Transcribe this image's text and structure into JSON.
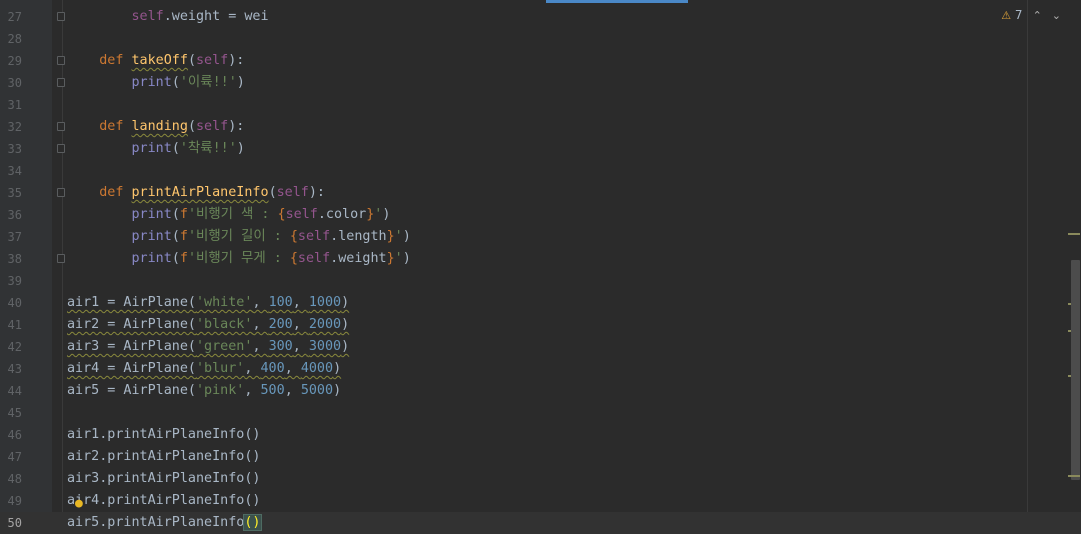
{
  "inspection": {
    "warning_count": "7",
    "warn_icon": "⚠",
    "prev_icon": "⌃",
    "next_icon": "⌄"
  },
  "lines": [
    {
      "n": "27",
      "tokens": [
        [
          "plain",
          "        "
        ],
        [
          "slf",
          "self"
        ],
        [
          "plain",
          ".weight = wei"
        ]
      ]
    },
    {
      "n": "28",
      "tokens": []
    },
    {
      "n": "29",
      "tokens": [
        [
          "plain",
          "    "
        ],
        [
          "kw",
          "def "
        ],
        [
          "fn",
          "takeOff"
        ],
        [
          "plain",
          "("
        ],
        [
          "slf",
          "self"
        ],
        [
          "plain",
          "):"
        ]
      ]
    },
    {
      "n": "30",
      "tokens": [
        [
          "plain",
          "        "
        ],
        [
          "bi",
          "print"
        ],
        [
          "plain",
          "("
        ],
        [
          "str",
          "'이륙!!'"
        ],
        [
          "plain",
          ")"
        ]
      ]
    },
    {
      "n": "31",
      "tokens": []
    },
    {
      "n": "32",
      "tokens": [
        [
          "plain",
          "    "
        ],
        [
          "kw",
          "def "
        ],
        [
          "fn",
          "landing"
        ],
        [
          "plain",
          "("
        ],
        [
          "slf",
          "self"
        ],
        [
          "plain",
          "):"
        ]
      ]
    },
    {
      "n": "33",
      "tokens": [
        [
          "plain",
          "        "
        ],
        [
          "bi",
          "print"
        ],
        [
          "plain",
          "("
        ],
        [
          "str",
          "'착륙!!'"
        ],
        [
          "plain",
          ")"
        ]
      ]
    },
    {
      "n": "34",
      "tokens": []
    },
    {
      "n": "35",
      "tokens": [
        [
          "plain",
          "    "
        ],
        [
          "kw",
          "def "
        ],
        [
          "fn",
          "printAirPlaneInfo"
        ],
        [
          "plain",
          "("
        ],
        [
          "slf",
          "self"
        ],
        [
          "plain",
          "):"
        ]
      ]
    },
    {
      "n": "36",
      "tokens": [
        [
          "plain",
          "        "
        ],
        [
          "bi",
          "print"
        ],
        [
          "plain",
          "("
        ],
        [
          "kw",
          "f"
        ],
        [
          "fstr",
          "'비행기 색 : "
        ],
        [
          "fexp",
          "{"
        ],
        [
          "slf",
          "self"
        ],
        [
          "plain",
          ".color"
        ],
        [
          "fexp",
          "}"
        ],
        [
          "fstr",
          "'"
        ],
        [
          "plain",
          ")"
        ]
      ]
    },
    {
      "n": "37",
      "tokens": [
        [
          "plain",
          "        "
        ],
        [
          "bi",
          "print"
        ],
        [
          "plain",
          "("
        ],
        [
          "kw",
          "f"
        ],
        [
          "fstr",
          "'비행기 길이 : "
        ],
        [
          "fexp",
          "{"
        ],
        [
          "slf",
          "self"
        ],
        [
          "plain",
          ".length"
        ],
        [
          "fexp",
          "}"
        ],
        [
          "fstr",
          "'"
        ],
        [
          "plain",
          ")"
        ]
      ]
    },
    {
      "n": "38",
      "tokens": [
        [
          "plain",
          "        "
        ],
        [
          "bi",
          "print"
        ],
        [
          "plain",
          "("
        ],
        [
          "kw",
          "f"
        ],
        [
          "fstr",
          "'비행기 무게 : "
        ],
        [
          "fexp",
          "{"
        ],
        [
          "slf",
          "self"
        ],
        [
          "plain",
          ".weight"
        ],
        [
          "fexp",
          "}"
        ],
        [
          "fstr",
          "'"
        ],
        [
          "plain",
          ")"
        ]
      ]
    },
    {
      "n": "39",
      "tokens": []
    },
    {
      "n": "40",
      "warn": true,
      "tokens": [
        [
          "plain",
          "air1 = AirPlane("
        ],
        [
          "str",
          "'white'"
        ],
        [
          "plain",
          ", "
        ],
        [
          "num",
          "100"
        ],
        [
          "plain",
          ", "
        ],
        [
          "num",
          "1000"
        ],
        [
          "plain",
          ")"
        ]
      ]
    },
    {
      "n": "41",
      "warn": true,
      "tokens": [
        [
          "plain",
          "air2 = AirPlane("
        ],
        [
          "str",
          "'black'"
        ],
        [
          "plain",
          ", "
        ],
        [
          "num",
          "200"
        ],
        [
          "plain",
          ", "
        ],
        [
          "num",
          "2000"
        ],
        [
          "plain",
          ")"
        ]
      ]
    },
    {
      "n": "42",
      "warn": true,
      "tokens": [
        [
          "plain",
          "air3 = AirPlane("
        ],
        [
          "str",
          "'green'"
        ],
        [
          "plain",
          ", "
        ],
        [
          "num",
          "300"
        ],
        [
          "plain",
          ", "
        ],
        [
          "num",
          "3000"
        ],
        [
          "plain",
          ")"
        ]
      ]
    },
    {
      "n": "43",
      "warn": true,
      "tokens": [
        [
          "plain",
          "air4 = AirPlane("
        ],
        [
          "str",
          "'blur'"
        ],
        [
          "plain",
          ", "
        ],
        [
          "num",
          "400"
        ],
        [
          "plain",
          ", "
        ],
        [
          "num",
          "4000"
        ],
        [
          "plain",
          ")"
        ]
      ]
    },
    {
      "n": "44",
      "tokens": [
        [
          "plain",
          "air5 = AirPlane("
        ],
        [
          "str",
          "'pink'"
        ],
        [
          "plain",
          ", "
        ],
        [
          "num",
          "500"
        ],
        [
          "plain",
          ", "
        ],
        [
          "num",
          "5000"
        ],
        [
          "plain",
          ")"
        ]
      ]
    },
    {
      "n": "45",
      "tokens": []
    },
    {
      "n": "46",
      "tokens": [
        [
          "plain",
          "air1.printAirPlaneInfo()"
        ]
      ]
    },
    {
      "n": "47",
      "tokens": [
        [
          "plain",
          "air2.printAirPlaneInfo()"
        ]
      ]
    },
    {
      "n": "48",
      "tokens": [
        [
          "plain",
          "air3.printAirPlaneInfo()"
        ]
      ]
    },
    {
      "n": "49",
      "bulb": true,
      "tokens": [
        [
          "plain",
          "air4.printAirPlaneInfo()"
        ]
      ]
    },
    {
      "n": "50",
      "current": true,
      "tokens": [
        [
          "plain",
          "air5.printAirPlaneInfo"
        ],
        [
          "brace",
          "()"
        ]
      ]
    }
  ],
  "fold_lines": [
    "27",
    "29",
    "30",
    "32",
    "33",
    "35",
    "38"
  ],
  "colors": {
    "background": "#2b2b2b",
    "keyword": "#cc7832",
    "string": "#6a8759",
    "number": "#6897bb",
    "self": "#94558d",
    "function": "#ffc66d"
  }
}
